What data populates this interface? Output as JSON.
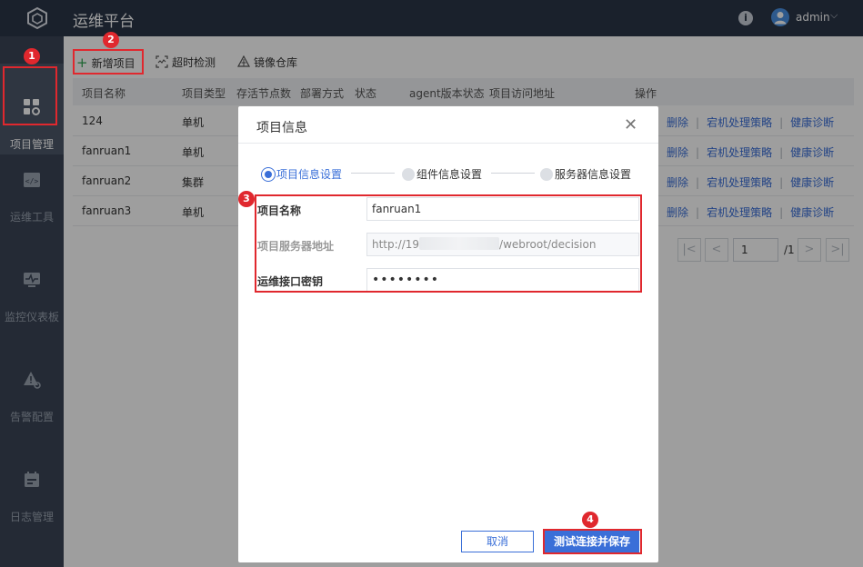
{
  "app": {
    "title": "运维平台"
  },
  "user": {
    "name": "admin"
  },
  "sidebar": {
    "items": [
      {
        "label": "项目管理",
        "icon": "grid-gear-icon",
        "active": true
      },
      {
        "label": "运维工具",
        "icon": "code-window-icon",
        "active": false
      },
      {
        "label": "监控仪表板",
        "icon": "pulse-monitor-icon",
        "active": false
      },
      {
        "label": "告警配置",
        "icon": "alert-gear-icon",
        "active": false
      },
      {
        "label": "日志管理",
        "icon": "calendar-icon",
        "active": false
      }
    ]
  },
  "toolbar": {
    "add_project": "新增项目",
    "timeout_check": "超时检测",
    "image_repo": "镜像仓库"
  },
  "table": {
    "headers": [
      "项目名称",
      "项目类型",
      "存活节点数",
      "部署方式",
      "状态",
      "agent版本状态",
      "项目访问地址",
      "操作"
    ],
    "rows": [
      {
        "name": "124",
        "type": "单机"
      },
      {
        "name": "fanruan1",
        "type": "单机"
      },
      {
        "name": "fanruan2",
        "type": "集群"
      },
      {
        "name": "fanruan3",
        "type": "单机"
      }
    ],
    "ops": {
      "delete": "删除",
      "downtime": "宕机处理策略",
      "health": "健康诊断"
    }
  },
  "pagination": {
    "page": "1",
    "total": "/1"
  },
  "modal": {
    "title": "项目信息",
    "steps": [
      "项目信息设置",
      "组件信息设置",
      "服务器信息设置"
    ],
    "fields": {
      "name_label": "项目名称",
      "name_value": "fanruan1",
      "server_label": "项目服务器地址",
      "server_prefix": "http://19",
      "server_suffix": "/webroot/decision",
      "key_label": "运维接口密钥",
      "key_value": "••••••••"
    },
    "cancel": "取消",
    "save": "测试连接并保存"
  },
  "markers": [
    "1",
    "2",
    "3",
    "4"
  ],
  "colors": {
    "accent": "#3a6fd8",
    "annotation": "#e0282e",
    "topbar": "#2b3648",
    "sidebar": "#3a4556"
  }
}
